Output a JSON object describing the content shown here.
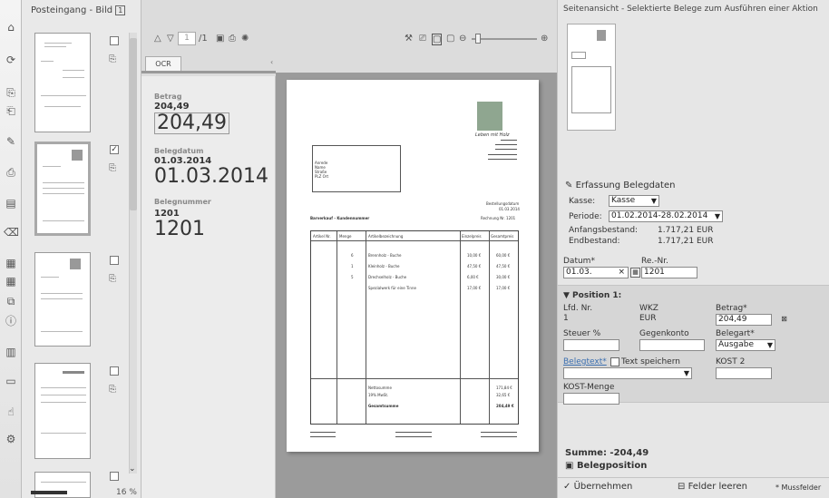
{
  "toolbar": {
    "icons": [
      "gear-icon",
      "refresh-icon",
      "copy-icon",
      "paste-icon",
      "edit-icon",
      "print-icon",
      "page-icon",
      "erase-icon",
      "grid-icon",
      "grid2-icon",
      "merge-icon",
      "info-icon",
      "id-icon",
      "tray-icon",
      "hand-icon",
      "settings-icon"
    ]
  },
  "thumbnails": {
    "title": "Posteingang - Bild",
    "title_badge": "1",
    "checked_mark": "✓",
    "zoom": "16 %"
  },
  "viewer": {
    "page_input": "1",
    "page_total": "/1",
    "ocr_tab": "OCR",
    "betrag_label": "Betrag",
    "betrag_small": "204,49",
    "betrag_big": "204,49",
    "belegdatum_label": "Belegdatum",
    "belegdatum_small": "01.03.2014",
    "belegdatum_big": "01.03.2014",
    "belegnummer_label": "Belegnummer",
    "belegnummer_small": "1201",
    "belegnummer_big": "1201",
    "doc": {
      "logo_text": "Leben mit Holz",
      "address": [
        "Anrede",
        "Name",
        "Straße",
        "PLZ Ort"
      ],
      "heading": "Barverkauf - Kundennummer",
      "date_label": "Bestellungsdatum",
      "date_value": "01.03.2014",
      "rechnung_label": "Rechnung Nr. 1201",
      "col_headers": [
        "Artikel Nr.",
        "Menge",
        "Artikelbezeichnung",
        "Einzelpreis",
        "Gesamtpreis"
      ],
      "rows": [
        [
          "",
          "6",
          "Brennholz - Buche",
          "10,00 €",
          "60,00 €"
        ],
        [
          "",
          "1",
          "Kleinholz - Buche",
          "47,50 €",
          "47,50 €"
        ],
        [
          "",
          "5",
          "Drechselholz - Buche",
          "6,00 €",
          "30,00 €"
        ],
        [
          "",
          "",
          "Spezialwerk für eine Tinne",
          "17,00 €",
          "17,00 €"
        ]
      ],
      "sum_rows": [
        [
          "Nettosumme",
          "171,84 €"
        ],
        [
          "19% MwSt.",
          "32,65 €"
        ],
        [
          "Gesamtsumme",
          "204,49 €"
        ]
      ]
    }
  },
  "right": {
    "title": "Seitenansicht - Selektierte Belege zum Ausführen einer Aktion",
    "erfassung": "Erfassung Belegdaten",
    "kasse_label": "Kasse:",
    "kasse_value": "Kasse",
    "periode_label": "Periode:",
    "periode_value": "01.02.2014-28.02.2014",
    "anfang_label": "Anfangsbestand:",
    "anfang_value": "1.717,21 EUR",
    "end_label": "Endbestand:",
    "end_value": "1.717,21 EUR",
    "datum_label": "Datum*",
    "datum_value": "01.03.",
    "renr_label": "Re.-Nr.",
    "renr_value": "1201",
    "position_title": "▼ Position 1:",
    "lfd_label": "Lfd. Nr.",
    "lfd_value": "1",
    "wkz_label": "WKZ",
    "wkz_value": "EUR",
    "betrag_label": "Betrag*",
    "betrag_value": "204,49",
    "steuer_label": "Steuer %",
    "gegenkonto_label": "Gegenkonto",
    "belegart_label": "Belegart*",
    "belegart_value": "Ausgabe",
    "belegtext_label": "Belegtext*",
    "text_speichern": "Text speichern",
    "kost2_label": "KOST 2",
    "kostmenge_label": "KOST-Menge",
    "summe": "Summe: -204,49",
    "belegposition": "Belegposition",
    "uebernehmen": "Übernehmen",
    "felder_leeren": "Felder leeren",
    "mussfelder": "* Mussfelder"
  }
}
